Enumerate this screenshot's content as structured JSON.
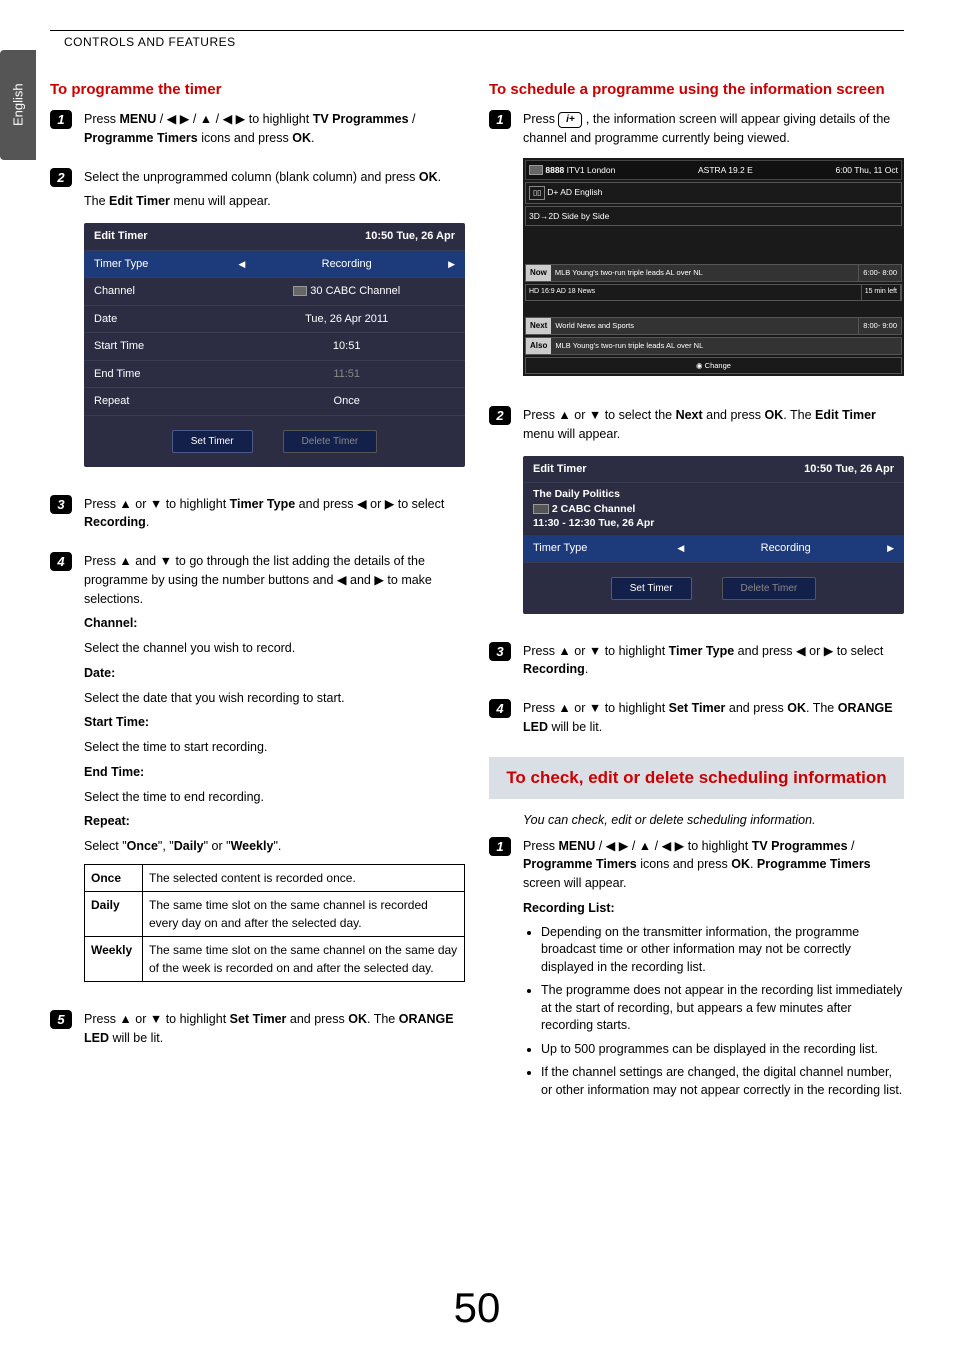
{
  "header": {
    "section": "CONTROLS AND FEATURES"
  },
  "lang_tab": "English",
  "page_number": "50",
  "left": {
    "title": "To programme the timer",
    "step1": {
      "pre": "Press ",
      "menu": "MENU",
      "mid": " / ◀ ▶ / ▲ / ◀ ▶ to highlight ",
      "tv": "TV Programmes",
      "sep": " / ",
      "pt": "Programme Timers",
      "post": " icons and press ",
      "ok": "OK",
      "dot": "."
    },
    "step2": {
      "l1a": "Select the unprogrammed column (blank column) and press ",
      "l1b": "OK",
      "l1c": ".",
      "l2a": "The ",
      "l2b": "Edit Timer",
      "l2c": " menu will appear."
    },
    "timer": {
      "title": "Edit Timer",
      "clock": "10:50 Tue, 26 Apr",
      "rows": {
        "timer_type": {
          "l": "Timer Type",
          "r": "Recording"
        },
        "channel": {
          "l": "Channel",
          "r": "30 CABC Channel"
        },
        "date": {
          "l": "Date",
          "r": "Tue, 26 Apr 2011"
        },
        "start": {
          "l": "Start Time",
          "r": "10:51"
        },
        "end": {
          "l": "End Time",
          "r": "11:51"
        },
        "repeat": {
          "l": "Repeat",
          "r": "Once"
        }
      },
      "set": "Set Timer",
      "delete": "Delete Timer"
    },
    "step3": {
      "a": "Press ▲ or ▼ to highlight ",
      "b": "Timer Type",
      "c": " and press ◀ or ▶ to select ",
      "d": "Recording",
      "e": "."
    },
    "step4": {
      "a": "Press ▲ and ▼ to go through the list adding the details of the programme by using the number buttons and ◀ and ▶ to make selections.",
      "channel_h": "Channel:",
      "channel_t": "Select the channel you wish to record.",
      "date_h": "Date:",
      "date_t": "Select the date that you wish recording to start.",
      "start_h": "Start Time:",
      "start_t": "Select the time to start recording.",
      "end_h": "End Time:",
      "end_t": "Select the time to end recording.",
      "repeat_h": "Repeat:",
      "repeat_t_a": "Select \"",
      "once": "Once",
      "repeat_t_b": "\", \"",
      "daily": "Daily",
      "repeat_t_c": "\" or \"",
      "weekly": "Weekly",
      "repeat_t_d": "\"."
    },
    "repeat_table": {
      "once": {
        "k": "Once",
        "v": "The selected content is recorded once."
      },
      "daily": {
        "k": "Daily",
        "v": "The same time slot on the same channel is recorded every day on and after the selected day."
      },
      "weekly": {
        "k": "Weekly",
        "v": "The same time slot on the same channel on the same day of the week is recorded on and after the selected day."
      }
    },
    "step5": {
      "a": "Press ▲ or ▼ to highlight ",
      "b": "Set Timer",
      "c": " and press ",
      "d": "OK",
      "e": ". The ",
      "f": "ORANGE LED",
      "g": " will be lit."
    }
  },
  "right": {
    "title": "To schedule a programme using the information screen",
    "step1": {
      "a": "Press ",
      "key": "i+",
      "b": " , the information screen will appear giving details of the channel and programme currently being viewed."
    },
    "info": {
      "ch_num": "8888",
      "ch_name": "ITV1 London",
      "sat": "ASTRA 19.2 E",
      "clock": "6:00 Thu, 11 Oct",
      "tags1": "D+  AD English",
      "tags2": "3D→2D Side by Side",
      "now": {
        "tag": "Now",
        "title": "MLB Young's two-run triple leads AL over NL",
        "time": "6:00- 8:00"
      },
      "icons": "HD 16:9  AD 18  News",
      "time_left": "15 min left",
      "next": {
        "tag": "Next",
        "title": "World News and Sports",
        "time": "8:00- 9:00"
      },
      "also": {
        "tag": "Also",
        "title": "MLB Young's two-run triple leads AL over NL"
      },
      "change": "Change"
    },
    "step2": {
      "a": "Press ▲ or ▼ to select the ",
      "b": "Next",
      "c": " and press ",
      "d": "OK",
      "e": ". The ",
      "f": "Edit Timer",
      "g": " menu will appear."
    },
    "timer2": {
      "title": "Edit Timer",
      "prog": "The Daily Politics",
      "ch": "2 CABC Channel",
      "span": "11:30 - 12:30 Tue, 26 Apr",
      "clock": "10:50 Tue, 26 Apr",
      "tt_l": "Timer Type",
      "tt_r": "Recording",
      "set": "Set Timer",
      "delete": "Delete Timer"
    },
    "step3": {
      "a": "Press ▲ or ▼ to highlight ",
      "b": "Timer Type",
      "c": " and press ◀ or ▶ to select ",
      "d": "Recording",
      "e": "."
    },
    "step4": {
      "a": "Press ▲ or ▼ to highlight ",
      "b": "Set Timer",
      "c": " and press ",
      "d": "OK",
      "e": ". The ",
      "f": "ORANGE LED",
      "g": " will be lit."
    },
    "big_section": "To check, edit or delete scheduling information",
    "intro": "You can check, edit or delete scheduling information.",
    "bstep1": {
      "pre": "Press ",
      "menu": "MENU",
      "mid": " / ◀ ▶ / ▲ / ◀ ▶ to highlight ",
      "tv": "TV Programmes",
      "sep": " / ",
      "pt": "Programme Timers",
      "post": " icons and press ",
      "ok": "OK",
      "dot": ". ",
      "pt2": "Programme Timers",
      "post2": " screen will appear."
    },
    "rec_h": "Recording List:",
    "bullets": [
      "Depending on the transmitter information, the programme broadcast time or other information may not be correctly displayed in the recording list.",
      "The programme does not appear in the recording list immediately at the start of recording, but appears a few minutes after recording starts.",
      "Up to 500 programmes can be displayed in the recording list.",
      "If the channel settings are changed, the digital channel number, or other information may not appear correctly in the recording list."
    ]
  }
}
